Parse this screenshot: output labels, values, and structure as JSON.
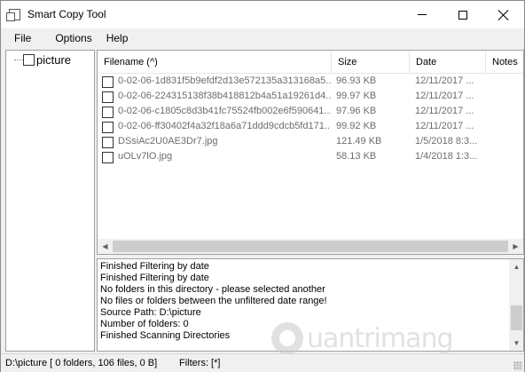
{
  "window": {
    "title": "Smart Copy Tool"
  },
  "menu": [
    {
      "label": "File"
    },
    {
      "label": "Options"
    },
    {
      "label": "Help"
    }
  ],
  "tree": {
    "root_label": "picture",
    "root_checked": false
  },
  "file_list": {
    "columns": [
      {
        "label": "Filename (^)"
      },
      {
        "label": "Size"
      },
      {
        "label": "Date"
      },
      {
        "label": "Notes"
      }
    ],
    "rows": [
      {
        "name": "0-02-06-1d831f5b9efdf2d13e572135a313168a5...",
        "size": "96.93 KB",
        "date": "12/11/2017 ...",
        "checked": false
      },
      {
        "name": "0-02-06-224315138f38b418812b4a51a19261d4...",
        "size": "99.97 KB",
        "date": "12/11/2017 ...",
        "checked": false
      },
      {
        "name": "0-02-06-c1805c8d3b41fc75524fb002e6f590641...",
        "size": "97.96 KB",
        "date": "12/11/2017 ...",
        "checked": false
      },
      {
        "name": "0-02-06-ff30402f4a32f18a6a71ddd9cdcb5fd171...",
        "size": "99.92 KB",
        "date": "12/11/2017 ...",
        "checked": false
      },
      {
        "name": "DSsiAc2U0AE3Dr7.jpg",
        "size": "121.49 KB",
        "date": "1/5/2018 8:3...",
        "checked": false
      },
      {
        "name": "uOLv7lO.jpg",
        "size": "58.13 KB",
        "date": "1/4/2018 1:3...",
        "checked": false
      }
    ]
  },
  "log": [
    "Finished Filtering by date",
    "Finished Filtering by date",
    "No folders in this directory - please selected another",
    "No files or folders between the unfiltered date range!",
    "Source Path: D:\\picture",
    "Number of folders: 0",
    "Finished Scanning Directories"
  ],
  "status": {
    "path": "D:\\picture [ 0 folders, 106 files, 0 B]",
    "filters": "Filters: [*]"
  },
  "watermark": {
    "text": "uantrimang"
  },
  "icons": {
    "minimize": "minimize-icon",
    "maximize": "maximize-icon",
    "close": "close-icon",
    "app": "app-icon"
  }
}
